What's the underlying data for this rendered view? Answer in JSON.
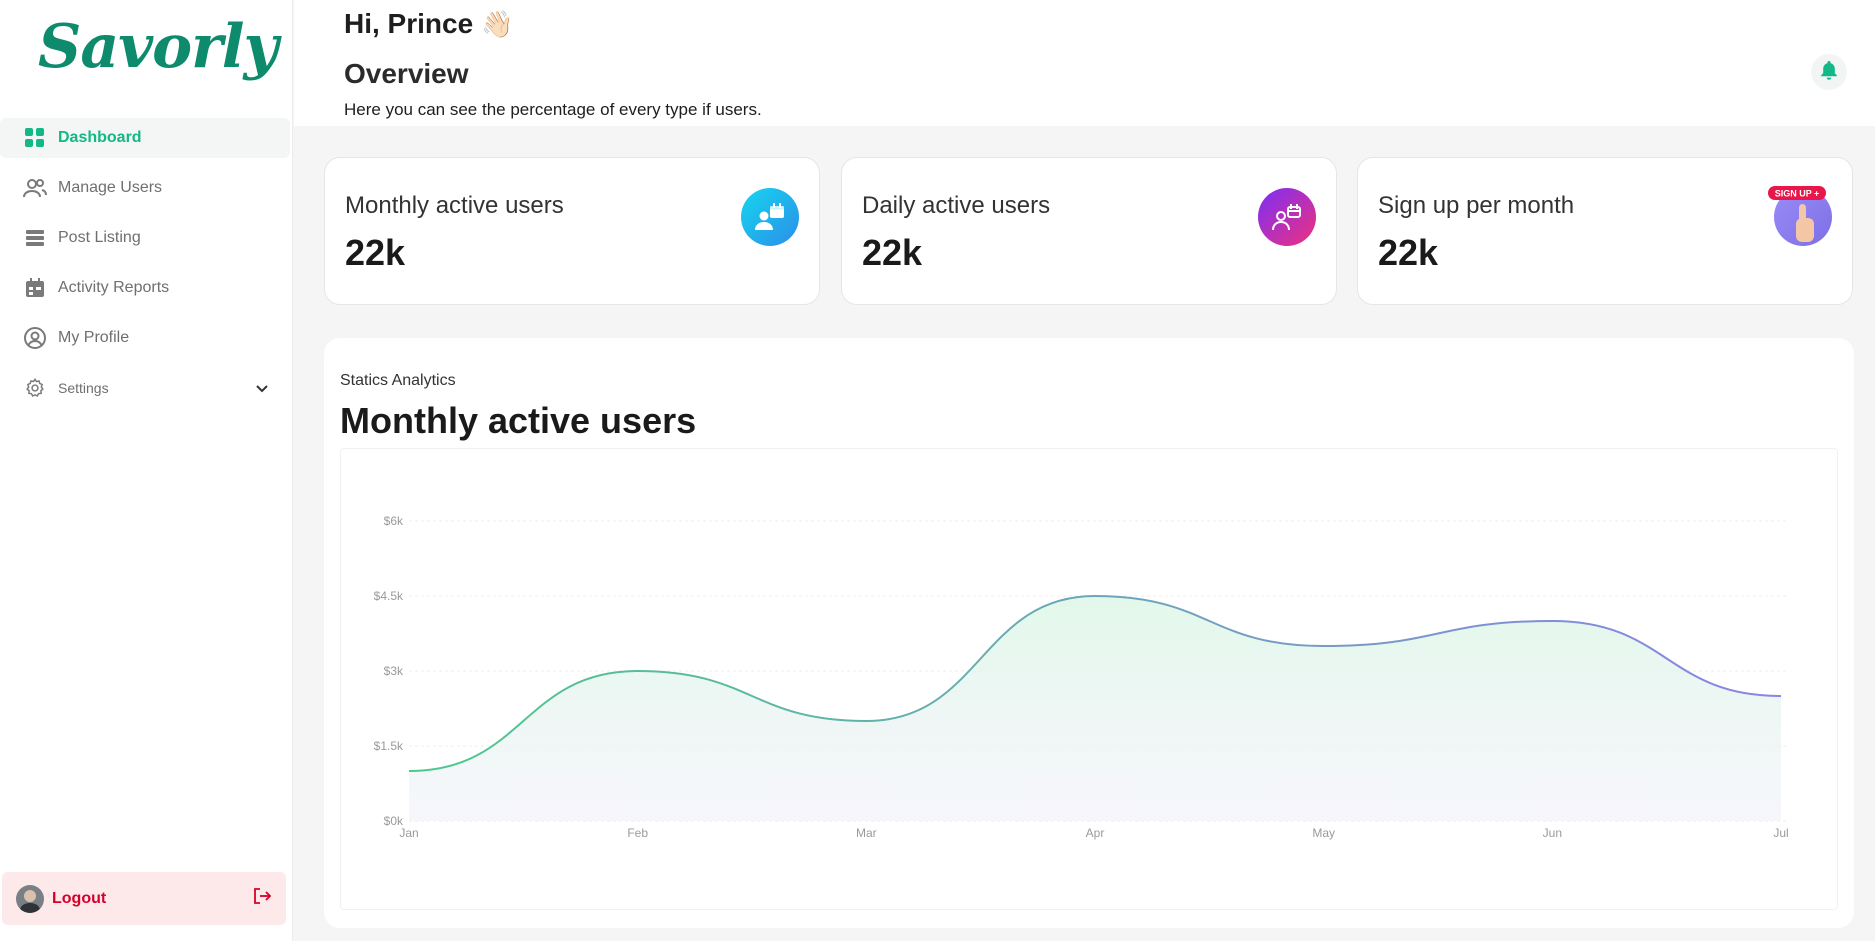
{
  "brand": {
    "name": "Savorly"
  },
  "sidebar": {
    "items": [
      {
        "label": "Dashboard",
        "icon": "grid-icon",
        "active": true
      },
      {
        "label": "Manage Users",
        "icon": "users-icon"
      },
      {
        "label": "Post Listing",
        "icon": "list-icon"
      },
      {
        "label": "Activity Reports",
        "icon": "calendar-icon"
      },
      {
        "label": "My Profile",
        "icon": "user-circle-icon"
      },
      {
        "label": "Settings",
        "icon": "gear-icon"
      }
    ],
    "logout_label": "Logout"
  },
  "header": {
    "greeting": "Hi, Prince",
    "wave": "👋🏻",
    "title": "Overview",
    "subtitle": "Here you can see the percentage of every type if users."
  },
  "stats": [
    {
      "label": "Monthly active users",
      "value": "22k",
      "icon": "user-calendar-icon",
      "color": "#1ea7f0"
    },
    {
      "label": "Daily active users",
      "value": "22k",
      "icon": "user-calendar-icon",
      "color": "#c42ee0"
    },
    {
      "label": "Sign up per month",
      "value": "22k",
      "icon": "signup-icon",
      "color": "#8b7cf2"
    }
  ],
  "panel": {
    "subtitle": "Statics Analytics",
    "title": "Monthly active users"
  },
  "colors": {
    "accent": "#12b886",
    "brand": "#0e8a6c",
    "logout_bg": "#fde8ea",
    "logout_text": "#d6002b"
  },
  "chart_data": {
    "type": "area",
    "categories": [
      "Jan",
      "Feb",
      "Mar",
      "Apr",
      "May",
      "Jun",
      "Jul"
    ],
    "series": [
      {
        "values": [
          1.0,
          3.0,
          2.0,
          4.5,
          3.5,
          4.0,
          2.5
        ]
      }
    ],
    "yticks": [
      "$0k",
      "$1.5k",
      "$3k",
      "$4.5k",
      "$6k"
    ],
    "ytick_values": [
      0,
      1.5,
      3,
      4.5,
      6
    ],
    "ylim": [
      0,
      6
    ],
    "grid": true,
    "line_gradient": [
      "#4cc98a",
      "#8c83e6"
    ]
  }
}
